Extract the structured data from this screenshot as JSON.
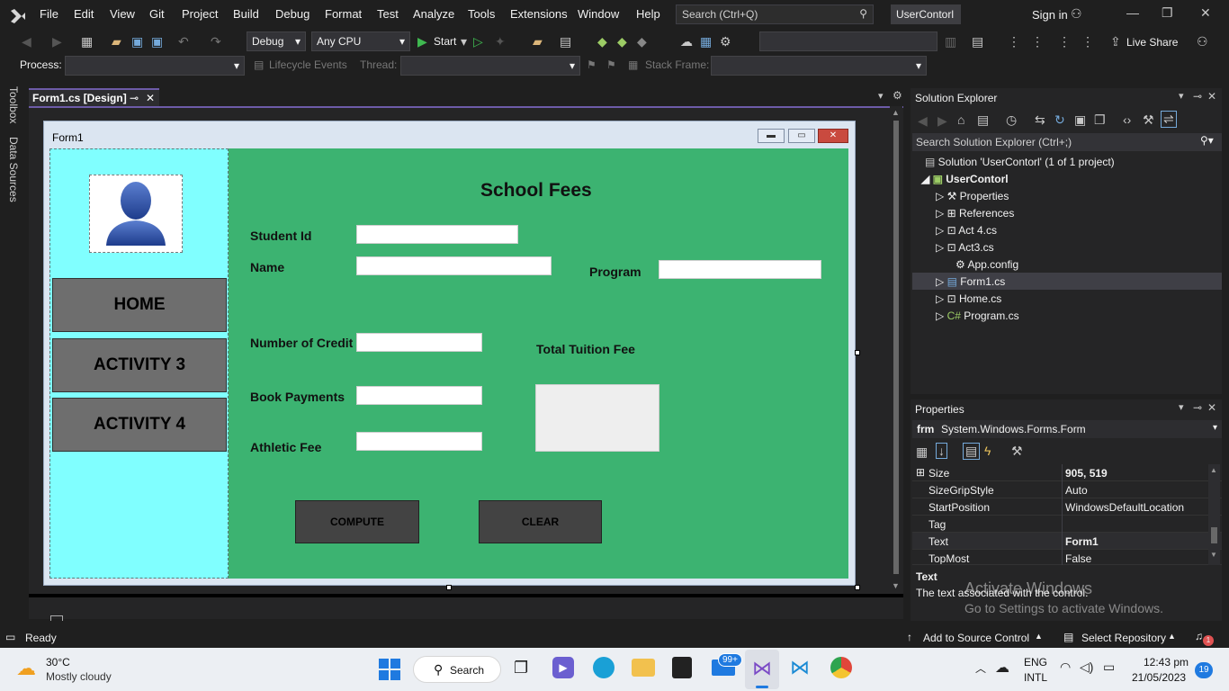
{
  "menu": [
    "File",
    "Edit",
    "View",
    "Git",
    "Project",
    "Build",
    "Debug",
    "Format",
    "Test",
    "Analyze",
    "Tools",
    "Extensions",
    "Window",
    "Help"
  ],
  "search_placeholder": "Search (Ctrl+Q)",
  "solution_name": "UserContorl",
  "sign_in": "Sign in",
  "toolbar": {
    "config": "Debug",
    "platform": "Any CPU",
    "start": "Start",
    "live_share": "Live Share"
  },
  "toolbar2": {
    "process_label": "Process:",
    "lifecycle": "Lifecycle Events",
    "thread_label": "Thread:",
    "stack_frame": "Stack Frame:"
  },
  "left_strip": {
    "toolbox": "Toolbox",
    "data_sources": "Data Sources"
  },
  "doc_tab": "Form1.cs [Design]",
  "form": {
    "title": "Form1",
    "heading": "School Fees",
    "nav": [
      "HOME",
      "ACTIVITY 3",
      "ACTIVITY 4"
    ],
    "labels": {
      "student_id": "Student Id",
      "name": "Name",
      "program": "Program",
      "credits": "Number of Credit",
      "book": "Book Payments",
      "athletic": "Athletic Fee",
      "total": "Total Tuition Fee"
    },
    "buttons": {
      "compute": "COMPUTE",
      "clear": "CLEAR"
    }
  },
  "solution_explorer": {
    "title": "Solution Explorer",
    "search": "Search Solution Explorer (Ctrl+;)",
    "solution": "Solution 'UserContorl' (1 of 1 project)",
    "project": "UserContorl",
    "items": [
      "Properties",
      "References",
      "Act 4.cs",
      "Act3.cs",
      "App.config",
      "Form1.cs",
      "Home.cs",
      "Program.cs"
    ]
  },
  "properties": {
    "title": "Properties",
    "object_prefix": "frm",
    "object": "System.Windows.Forms.Form",
    "rows": [
      {
        "name": "Size",
        "value": "905, 519"
      },
      {
        "name": "SizeGripStyle",
        "value": "Auto"
      },
      {
        "name": "StartPosition",
        "value": "WindowsDefaultLocation"
      },
      {
        "name": "Tag",
        "value": ""
      },
      {
        "name": "Text",
        "value": "Form1"
      },
      {
        "name": "TopMost",
        "value": "False"
      }
    ],
    "desc_title": "Text",
    "desc": "The text associated with the control."
  },
  "watermark": {
    "line1": "Activate Windows",
    "line2": "Go to Settings to activate Windows."
  },
  "status": {
    "ready": "Ready",
    "source_control": "Add to Source Control",
    "repo": "Select Repository"
  },
  "taskbar": {
    "temp": "30°C",
    "weather": "Mostly cloudy",
    "search": "Search",
    "mail_badge": "99+",
    "lang1": "ENG",
    "lang2": "INTL",
    "time": "12:43 pm",
    "date": "21/05/2023",
    "notif": "19"
  },
  "colors": {
    "vs_purple": "#6d5ba8",
    "form_green": "#3cb371",
    "sidebar_cyan": "#80ffff",
    "taskbar": "#eceff3"
  }
}
